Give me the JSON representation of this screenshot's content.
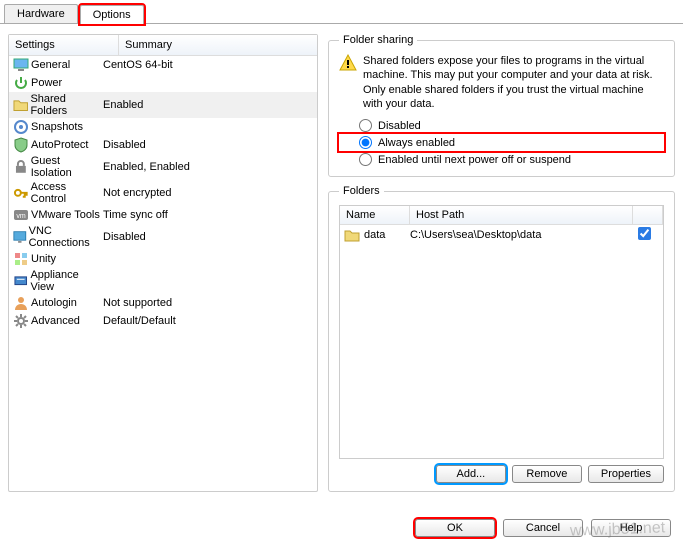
{
  "tabs": {
    "hardware": "Hardware",
    "options": "Options"
  },
  "left_header": {
    "settings": "Settings",
    "summary": "Summary"
  },
  "settings": [
    {
      "name": "General",
      "summary": "CentOS 64-bit",
      "icon": "monitor"
    },
    {
      "name": "Power",
      "summary": "",
      "icon": "power"
    },
    {
      "name": "Shared Folders",
      "summary": "Enabled",
      "icon": "folder",
      "selected": true
    },
    {
      "name": "Snapshots",
      "summary": "",
      "icon": "snapshot"
    },
    {
      "name": "AutoProtect",
      "summary": "Disabled",
      "icon": "shield"
    },
    {
      "name": "Guest Isolation",
      "summary": "Enabled, Enabled",
      "icon": "lock"
    },
    {
      "name": "Access Control",
      "summary": "Not encrypted",
      "icon": "key"
    },
    {
      "name": "VMware Tools",
      "summary": "Time sync off",
      "icon": "vm"
    },
    {
      "name": "VNC Connections",
      "summary": "Disabled",
      "icon": "vnc"
    },
    {
      "name": "Unity",
      "summary": "",
      "icon": "unity"
    },
    {
      "name": "Appliance View",
      "summary": "",
      "icon": "appliance"
    },
    {
      "name": "Autologin",
      "summary": "Not supported",
      "icon": "user"
    },
    {
      "name": "Advanced",
      "summary": "Default/Default",
      "icon": "gear"
    }
  ],
  "folder_sharing": {
    "legend": "Folder sharing",
    "warning": "Shared folders expose your files to programs in the virtual machine. This may put your computer and your data at risk. Only enable shared folders if you trust the virtual machine with your data.",
    "r_disabled": "Disabled",
    "r_always": "Always enabled",
    "r_until": "Enabled until next power off or suspend"
  },
  "folders": {
    "legend": "Folders",
    "h_name": "Name",
    "h_host": "Host Path",
    "rows": [
      {
        "name": "data",
        "host": "C:\\Users\\sea\\Desktop\\data",
        "enabled": true
      }
    ],
    "btn_add": "Add...",
    "btn_remove": "Remove",
    "btn_props": "Properties"
  },
  "bottom": {
    "ok": "OK",
    "cancel": "Cancel",
    "help": "Help"
  },
  "watermark": "www.jb51.net"
}
